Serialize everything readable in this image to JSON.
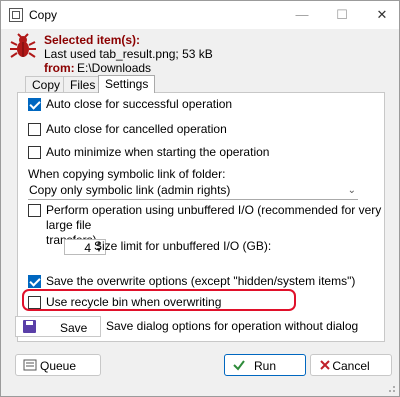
{
  "window": {
    "title": "Copy",
    "minimize": "—",
    "maximize": "☐",
    "close": "✕"
  },
  "info": {
    "heading": "Selected item(s):",
    "item_line": "Last used tab_result.png;  53 kB",
    "from_label": "from:",
    "from_value": "E:\\Downloads"
  },
  "tabs": [
    {
      "label": "Copy",
      "active": false
    },
    {
      "label": "Files",
      "active": false
    },
    {
      "label": "Settings",
      "active": true
    }
  ],
  "settings": {
    "auto_close_success": {
      "label": "Auto close for successful operation",
      "checked": true
    },
    "auto_close_cancelled": {
      "label": "Auto close for cancelled operation",
      "checked": false
    },
    "auto_minimize": {
      "label": "Auto minimize when starting the operation",
      "checked": false
    },
    "symlink_label": "When copying symbolic link of folder:",
    "symlink_selected": "Copy only symbolic link (admin rights)",
    "unbuffered": {
      "label_line1": "Perform operation using unbuffered I/O (recommended for very large file",
      "label_line2": "transfers)",
      "checked": false
    },
    "size_limit": {
      "value": "4",
      "label": "Size limit for unbuffered I/O (GB):"
    },
    "save_overwrite": {
      "label": "Save the overwrite options (except \"hidden/system items\")",
      "checked": true
    },
    "recycle_bin": {
      "label": "Use recycle bin when overwriting",
      "checked": false
    },
    "highlight_color": "#e0102a"
  },
  "save": {
    "label": "Save",
    "description": "Save dialog options for operation without dialog"
  },
  "buttons": {
    "queue": "Queue",
    "run": "Run",
    "cancel": "Cancel"
  },
  "colors": {
    "accent": "#0067c0",
    "info_heading": "#8b0000",
    "run_check": "#2e8b3a",
    "cancel_x": "#c0202a"
  },
  "icons": {
    "app": "window-icon",
    "bug": "bug-icon",
    "floppy": "floppy-disk-icon",
    "check": "check-icon",
    "x": "x-icon"
  }
}
